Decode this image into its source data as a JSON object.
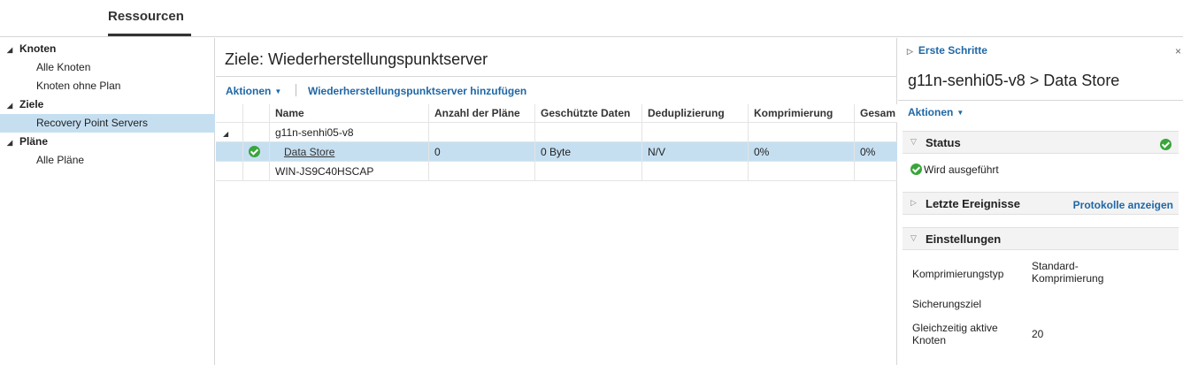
{
  "header": {
    "tab_label": "Ressourcen"
  },
  "tree": {
    "groups": [
      {
        "label": "Knoten",
        "items": [
          "Alle Knoten",
          "Knoten ohne Plan"
        ]
      },
      {
        "label": "Ziele",
        "items": [
          "Recovery Point Servers"
        ]
      },
      {
        "label": "Pläne",
        "items": [
          "Alle Pläne"
        ]
      }
    ],
    "selected": "Recovery Point Servers"
  },
  "center": {
    "title": "Ziele: Wiederherstellungspunktserver",
    "toolbar": {
      "actions": "Aktionen",
      "add": "Wiederherstellungspunktserver hinzufügen"
    },
    "columns": [
      "Name",
      "Anzahl der Pläne",
      "Geschützte Daten",
      "Deduplizierung",
      "Komprimierung",
      "Gesam"
    ],
    "rows": [
      {
        "name": "g11n-senhi05-v8"
      },
      {
        "name": "Data Store",
        "plans": "0",
        "protected": "0 Byte",
        "dedup": "N/V",
        "compression": "0%",
        "total": "0%"
      },
      {
        "name": "WIN-JS9C40HSCAP"
      }
    ]
  },
  "right": {
    "first_steps": "Erste Schritte",
    "close": "×",
    "title": "g11n-senhi05-v8 > Data Store",
    "actions": "Aktionen",
    "status": {
      "label": "Status",
      "value": "Wird ausgeführt"
    },
    "events": {
      "label": "Letzte Ereignisse",
      "link": "Protokolle anzeigen"
    },
    "settings": {
      "label": "Einstellungen",
      "compression_type_label": "Komprimierungstyp",
      "compression_type_value_1": "Standard-",
      "compression_type_value_2": "Komprimierung",
      "backup_target_label": "Sicherungsziel",
      "concurrent_label_1": "Gleichzeitig aktive",
      "concurrent_label_2": "Knoten",
      "concurrent_value": "20"
    }
  },
  "colors": {
    "accent": "#1f67a6",
    "selection": "#c5dff1",
    "ok": "#3aa53a"
  }
}
